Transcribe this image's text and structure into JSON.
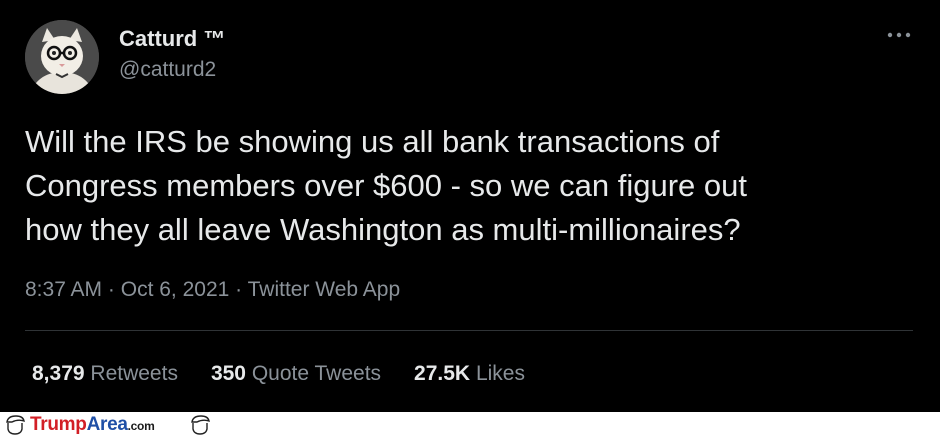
{
  "author": {
    "display_name": "Catturd ™",
    "handle": "@catturd2"
  },
  "tweet": {
    "text_lines": [
      "Will the IRS be showing us all bank transactions of",
      "Congress members over $600 - so we can figure out",
      "how they all leave Washington as multi-millionaires?"
    ],
    "time": "8:37 AM",
    "separator": " · ",
    "date": "Oct 6, 2021",
    "source": "Twitter Web App"
  },
  "stats": {
    "retweets": {
      "count": "8,379",
      "label": "Retweets"
    },
    "quote_tweets": {
      "count": "350",
      "label": "Quote Tweets"
    },
    "likes": {
      "count": "27.5K",
      "label": "Likes"
    }
  },
  "footer": {
    "brand_part1": "Trump",
    "brand_part2": "Area",
    "brand_suffix": ".com"
  },
  "icons": {
    "more": "more-horizontal-icon",
    "footer": "cartoon-hair-icon"
  },
  "colors": {
    "background": "#000000",
    "text": "#e7e9ea",
    "secondary_text": "#8b9299",
    "brand_red": "#d21f26",
    "brand_blue": "#1f4fa6"
  }
}
